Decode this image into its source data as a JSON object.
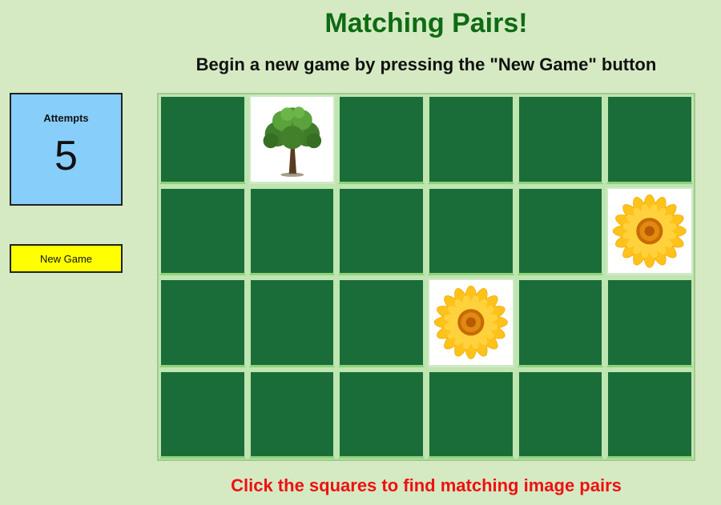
{
  "header": {
    "title": "Matching Pairs!",
    "subtitle": "Begin a new game by pressing the \"New Game\" button"
  },
  "sidebar": {
    "attempts_label": "Attempts",
    "attempts_value": "5",
    "new_game_label": "New Game"
  },
  "board": {
    "rows": 4,
    "cols": 6,
    "tiles": [
      "hidden",
      "tree-icon",
      "hidden",
      "hidden",
      "hidden",
      "hidden",
      "hidden",
      "hidden",
      "hidden",
      "hidden",
      "hidden",
      "sunflower-icon",
      "hidden",
      "hidden",
      "hidden",
      "sunflower-icon",
      "hidden",
      "hidden",
      "hidden",
      "hidden",
      "hidden",
      "hidden",
      "hidden",
      "hidden"
    ]
  },
  "footer": {
    "instruction": "Click the squares to find matching image pairs"
  },
  "colors": {
    "background": "#d5eac3",
    "tile_hidden": "#1a6d38",
    "title": "#0e6b13",
    "instruction": "#ee1111",
    "attempts_box": "#87cefa",
    "new_game_button": "#ffff00"
  }
}
